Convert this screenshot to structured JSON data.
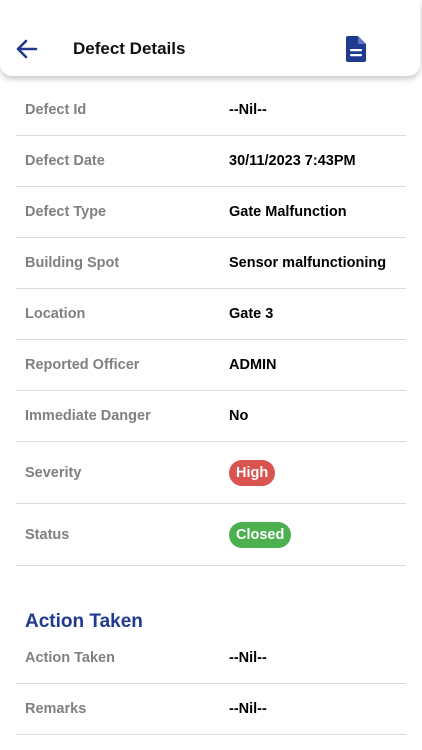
{
  "header": {
    "title": "Defect Details",
    "back_icon": "arrow-left-icon",
    "document_icon": "document-icon",
    "accent_color": "#1f3a8f"
  },
  "details": [
    {
      "label": "Defect Id",
      "value": "--Nil--"
    },
    {
      "label": "Defect Date",
      "value": "30/11/2023 7:43PM"
    },
    {
      "label": "Defect Type",
      "value": "Gate Malfunction"
    },
    {
      "label": "Building Spot",
      "value": "Sensor malfunctioning"
    },
    {
      "label": "Location",
      "value": "Gate 3"
    },
    {
      "label": "Reported Officer",
      "value": "ADMIN"
    },
    {
      "label": "Immediate Danger",
      "value": "No"
    }
  ],
  "severity": {
    "label": "Severity",
    "value": "High",
    "color": "#d9534f"
  },
  "status": {
    "label": "Status",
    "value": "Closed",
    "color": "#4caf50"
  },
  "action_section": {
    "title": "Action Taken",
    "rows": [
      {
        "label": "Action Taken",
        "value": "--Nil--"
      },
      {
        "label": "Remarks",
        "value": "--Nil--"
      }
    ]
  }
}
